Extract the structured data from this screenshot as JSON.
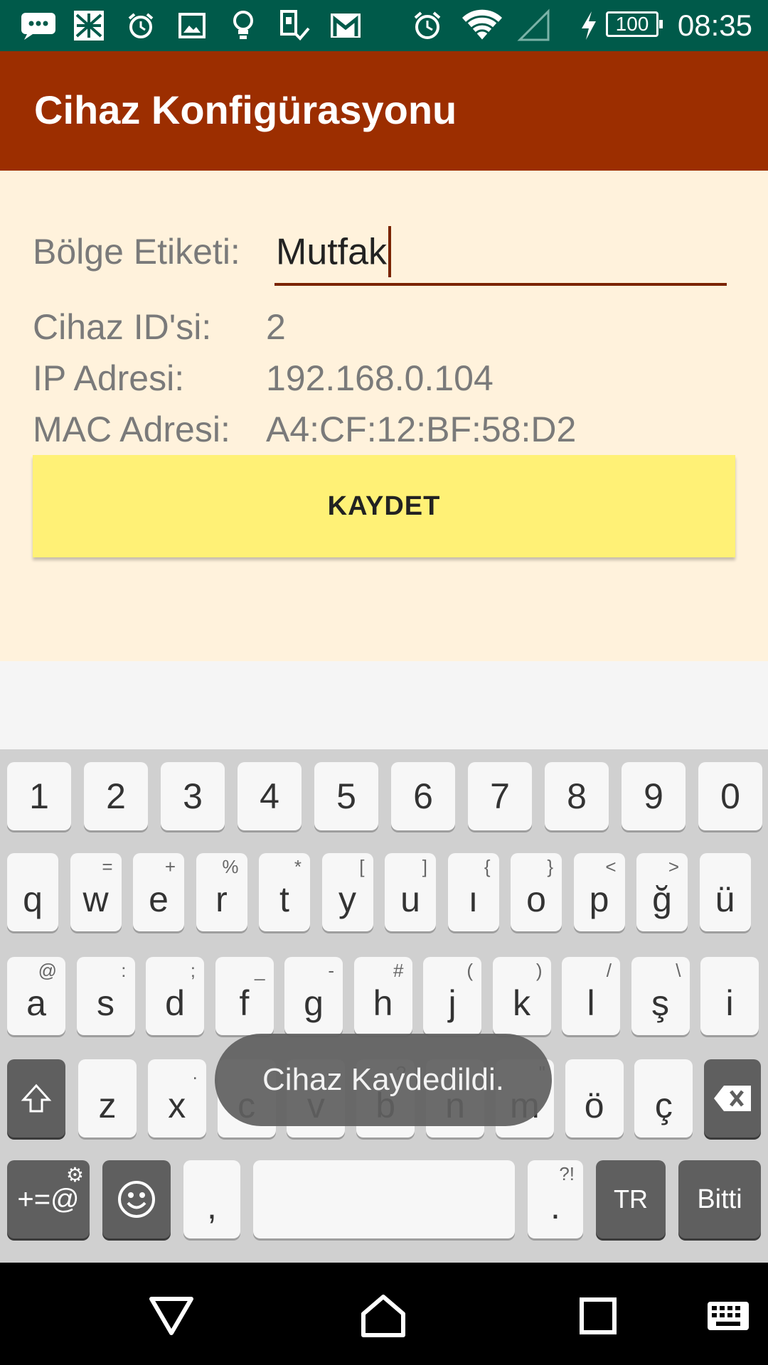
{
  "status_bar": {
    "time": "08:35",
    "battery": "100",
    "icons": [
      "message-icon",
      "news-icon",
      "alarm-icon",
      "image-icon",
      "bulb-icon",
      "device-check-icon",
      "gmail-icon",
      "alarm-clock-icon",
      "wifi-icon",
      "signal-icon",
      "charging-icon"
    ]
  },
  "app_bar": {
    "title": "Cihaz Konfigürasyonu"
  },
  "form": {
    "zone_label": "Bölge Etiketi:",
    "zone_value": "Mutfak",
    "device_id_label": "Cihaz ID'si:",
    "device_id_value": "2",
    "ip_label": "IP Adresi:",
    "ip_value": "192.168.0.104",
    "mac_label": "MAC Adresi:",
    "mac_value": "A4:CF:12:BF:58:D2",
    "save_label": "KAYDET"
  },
  "toast": {
    "message": "Cihaz Kaydedildi."
  },
  "keyboard": {
    "row_numbers": [
      "1",
      "2",
      "3",
      "4",
      "5",
      "6",
      "7",
      "8",
      "9",
      "0"
    ],
    "row1": [
      {
        "k": "q",
        "h": ""
      },
      {
        "k": "w",
        "h": "="
      },
      {
        "k": "e",
        "h": "+"
      },
      {
        "k": "r",
        "h": "%"
      },
      {
        "k": "t",
        "h": "*"
      },
      {
        "k": "y",
        "h": "["
      },
      {
        "k": "u",
        "h": "]"
      },
      {
        "k": "ı",
        "h": "{"
      },
      {
        "k": "o",
        "h": "}"
      },
      {
        "k": "p",
        "h": "<"
      },
      {
        "k": "ğ",
        "h": ">"
      },
      {
        "k": "ü",
        "h": ""
      }
    ],
    "row2": [
      {
        "k": "a",
        "h": "@"
      },
      {
        "k": "s",
        "h": ":"
      },
      {
        "k": "d",
        "h": ";"
      },
      {
        "k": "f",
        "h": "_"
      },
      {
        "k": "g",
        "h": "-"
      },
      {
        "k": "h",
        "h": "#"
      },
      {
        "k": "j",
        "h": "("
      },
      {
        "k": "k",
        "h": ")"
      },
      {
        "k": "l",
        "h": "/"
      },
      {
        "k": "ş",
        "h": "\\"
      },
      {
        "k": "i",
        "h": ""
      }
    ],
    "row3": [
      {
        "k": "z",
        "h": ""
      },
      {
        "k": "x",
        "h": "."
      },
      {
        "k": "c",
        "h": ""
      },
      {
        "k": "v",
        "h": ""
      },
      {
        "k": "b",
        "h": "?"
      },
      {
        "k": "n",
        "h": ""
      },
      {
        "k": "m",
        "h": "\""
      },
      {
        "k": "ö",
        "h": ""
      },
      {
        "k": "ç",
        "h": ""
      }
    ],
    "symbols_label": "+=@",
    "comma": ",",
    "period": ".",
    "period_hint": "?!",
    "lang": "TR",
    "done": "Bitti"
  }
}
